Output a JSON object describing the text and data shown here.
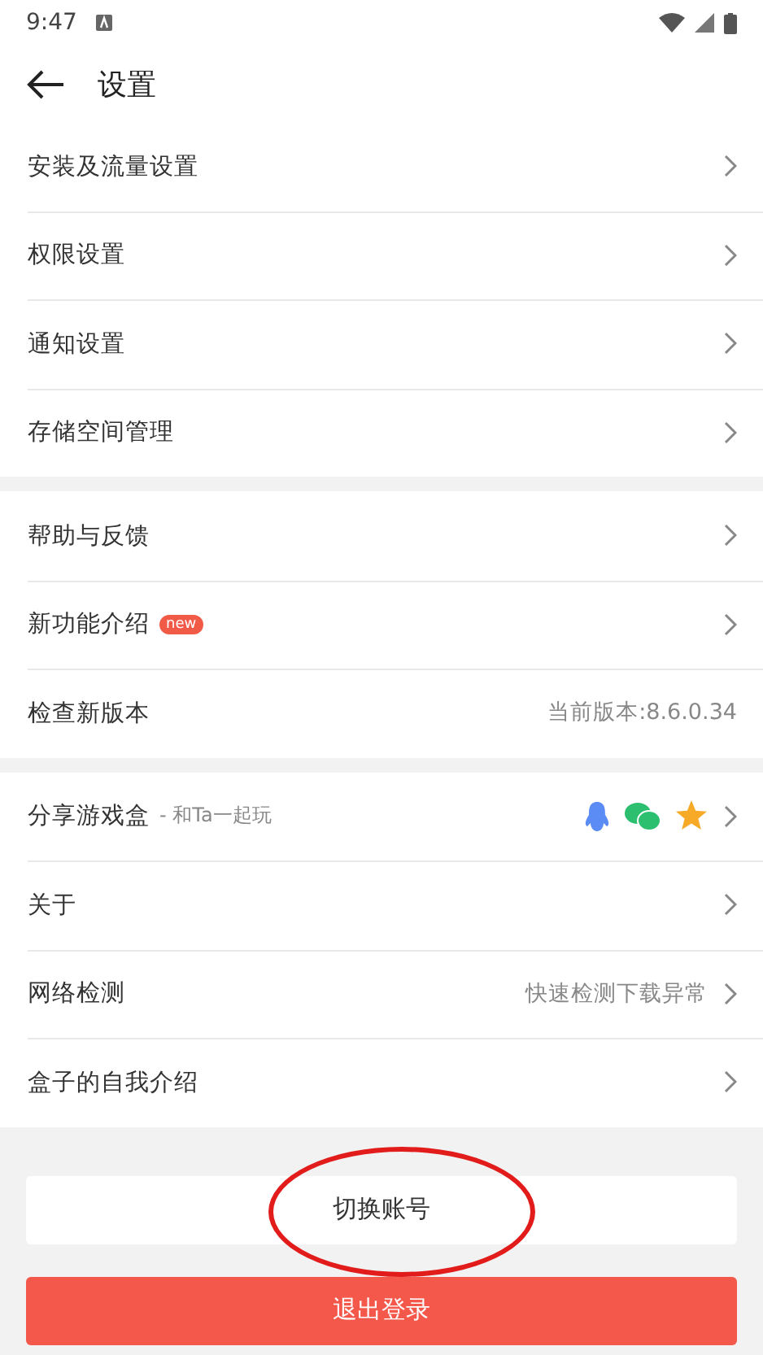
{
  "status_bar": {
    "time": "9:47"
  },
  "header": {
    "title": "设置"
  },
  "groups": [
    {
      "rows": [
        {
          "label": "安装及流量设置",
          "chevron": true
        },
        {
          "label": "权限设置",
          "chevron": true
        },
        {
          "label": "通知设置",
          "chevron": true
        },
        {
          "label": "存储空间管理",
          "chevron": true
        }
      ]
    },
    {
      "rows": [
        {
          "label": "帮助与反馈",
          "chevron": true
        },
        {
          "label": "新功能介绍",
          "badge": "new",
          "chevron": true
        },
        {
          "label": "检查新版本",
          "value": "当前版本:8.6.0.34",
          "chevron": false
        }
      ]
    },
    {
      "rows": [
        {
          "label": "分享游戏盒",
          "note": "- 和Ta一起玩",
          "share_icons": true,
          "chevron": true
        },
        {
          "label": "关于",
          "chevron": true
        },
        {
          "label": "网络检测",
          "value": "快速检测下载异常",
          "chevron": true
        },
        {
          "label": "盒子的自我介绍",
          "chevron": true
        }
      ]
    }
  ],
  "buttons": [
    {
      "label": "切换账号",
      "kind": "secondary"
    },
    {
      "label": "退出登录",
      "kind": "danger"
    }
  ]
}
